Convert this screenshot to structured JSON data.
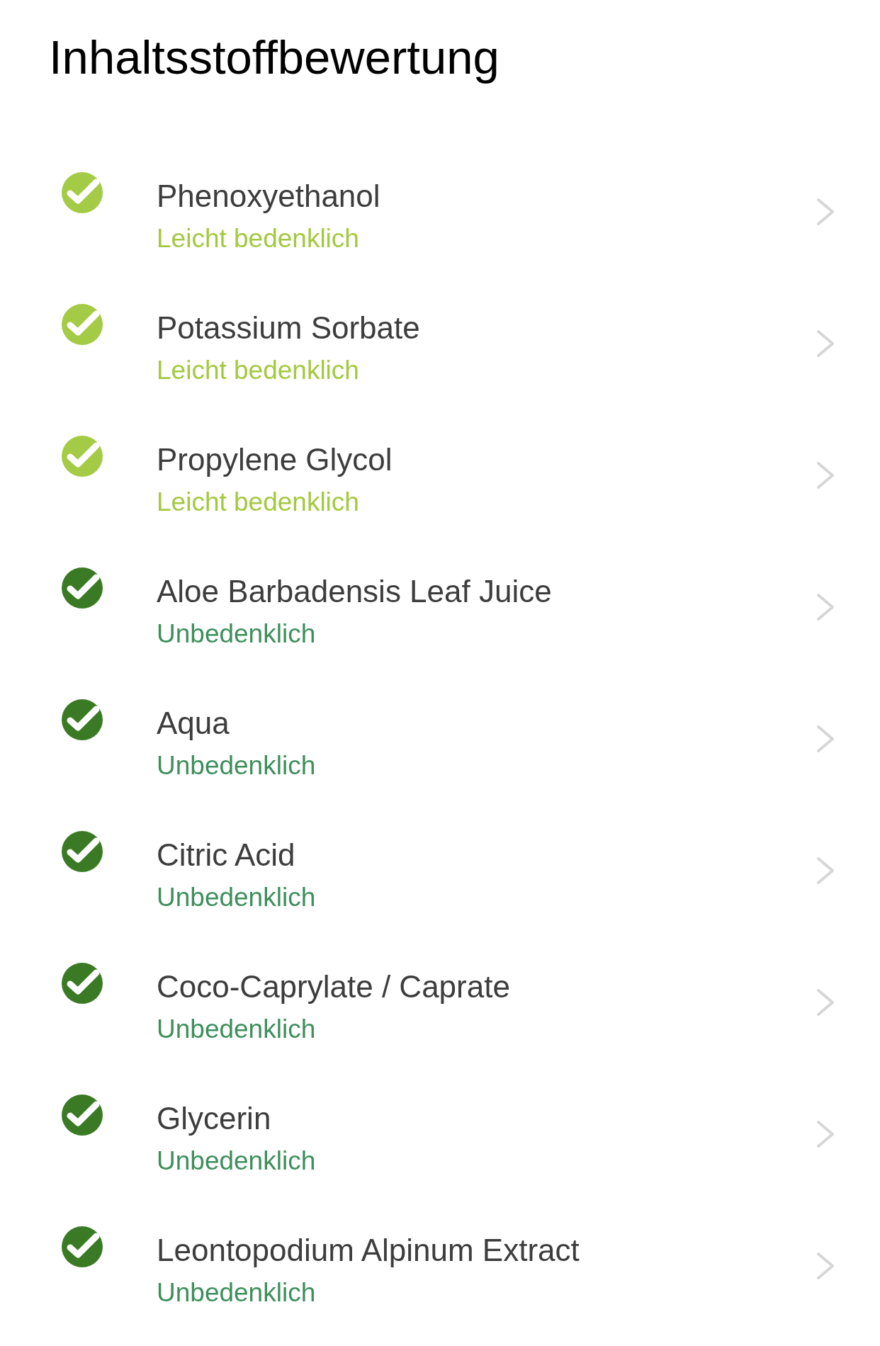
{
  "title": "Inhaltsstoffbewertung",
  "ingredients": [
    {
      "name": "Phenoxyethanol",
      "color": "#a4cb45",
      "rating": {
        "label": "Leicht bedenklich",
        "color": "#a3c940"
      }
    },
    {
      "name": "Potassium Sorbate",
      "color": "#a4cb45",
      "rating": {
        "label": "Leicht bedenklich",
        "color": "#a3c940"
      }
    },
    {
      "name": "Propylene Glycol",
      "color": "#a4cb45",
      "rating": {
        "label": "Leicht bedenklich",
        "color": "#a3c940"
      }
    },
    {
      "name": "Aloe Barbadensis Leaf Juice",
      "color": "#3b7a24",
      "rating": {
        "label": "Unbedenklich",
        "color": "#3e8f5c"
      }
    },
    {
      "name": "Aqua",
      "color": "#3b7a24",
      "rating": {
        "label": "Unbedenklich",
        "color": "#3e8f5c"
      }
    },
    {
      "name": "Citric Acid",
      "color": "#3b7a24",
      "rating": {
        "label": "Unbedenklich",
        "color": "#3e8f5c"
      }
    },
    {
      "name": "Coco-Caprylate / Caprate",
      "color": "#3b7a24",
      "rating": {
        "label": "Unbedenklich",
        "color": "#3e8f5c"
      }
    },
    {
      "name": "Glycerin",
      "color": "#3b7a24",
      "rating": {
        "label": "Unbedenklich",
        "color": "#3e8f5c"
      }
    },
    {
      "name": "Leontopodium Alpinum Extract",
      "color": "#3b7a24",
      "rating": {
        "label": "Unbedenklich",
        "color": "#3e8f5c"
      }
    }
  ]
}
